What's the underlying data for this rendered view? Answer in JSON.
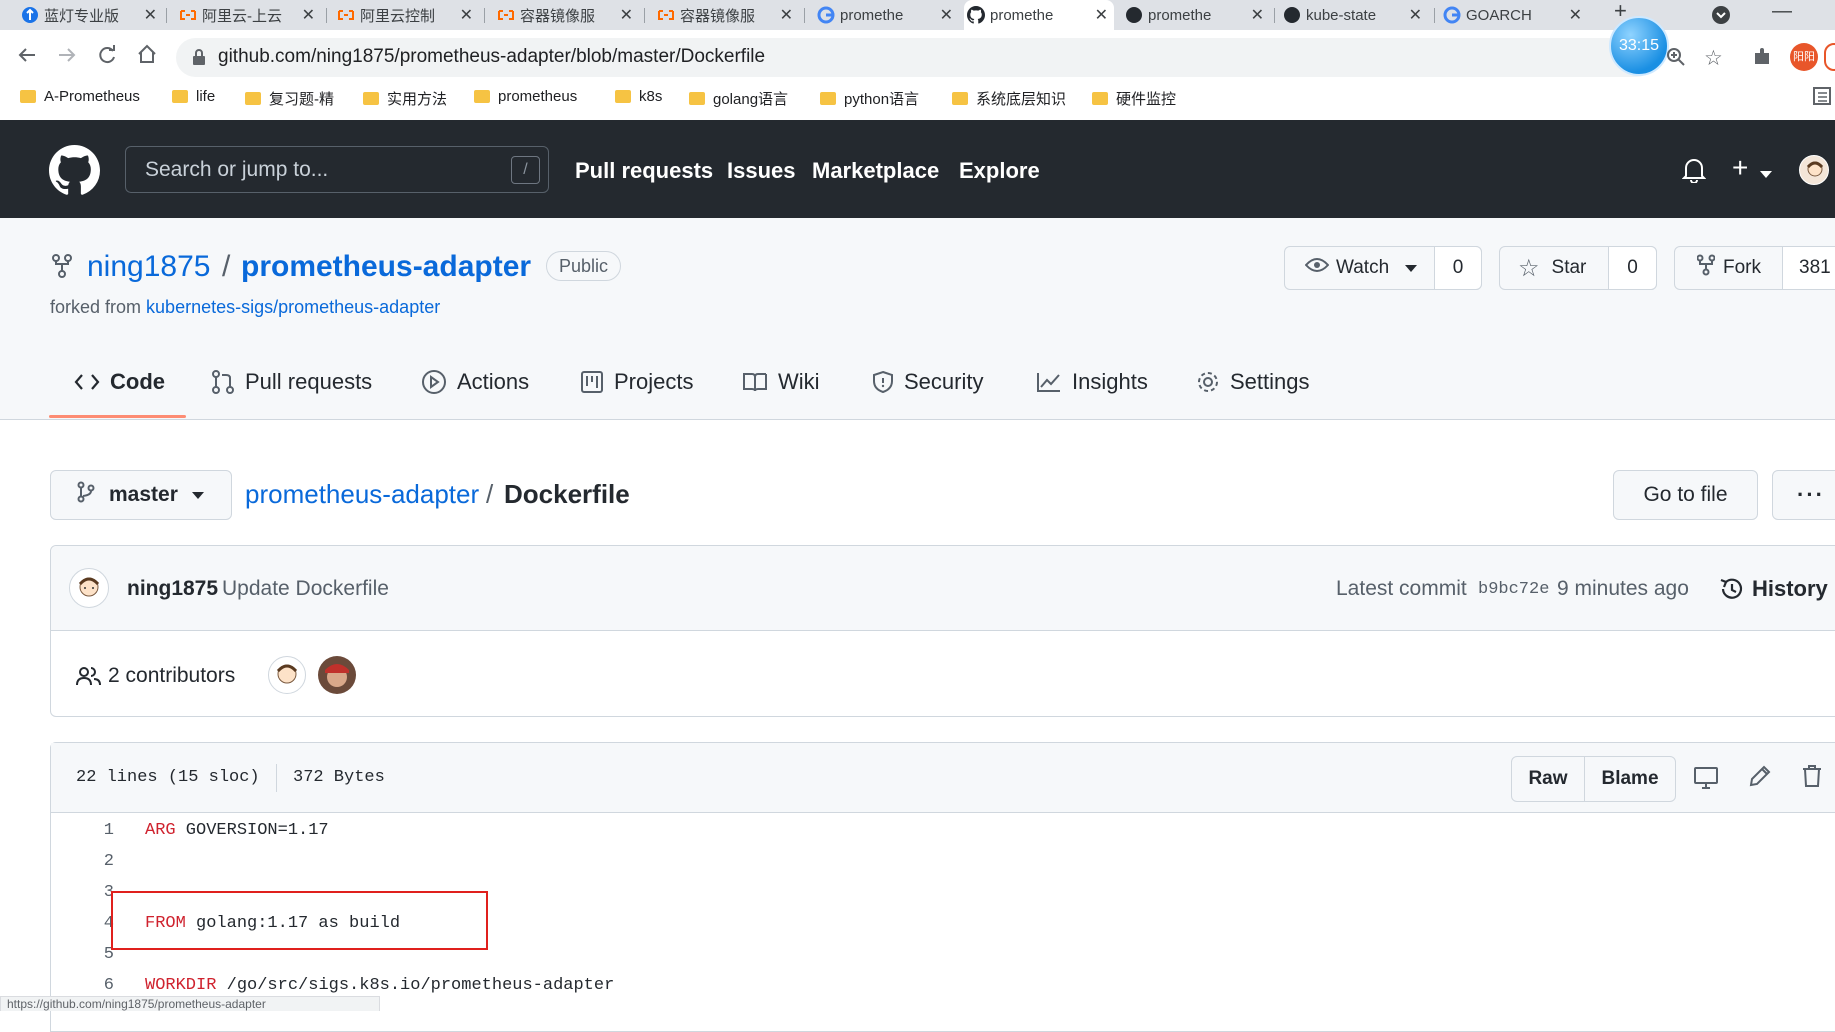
{
  "browser": {
    "tabs": [
      {
        "title": "蓝灯专业版",
        "icon": "lantern-icon"
      },
      {
        "title": "阿里云-上云",
        "icon": "aliyun-icon"
      },
      {
        "title": "阿里云控制",
        "icon": "aliyun-icon"
      },
      {
        "title": "容器镜像服",
        "icon": "aliyun-icon"
      },
      {
        "title": "容器镜像服",
        "icon": "aliyun-icon"
      },
      {
        "title": "promethe",
        "icon": "google-icon"
      },
      {
        "title": "promethe",
        "icon": "github-icon"
      },
      {
        "title": "promethe",
        "icon": "github-icon"
      },
      {
        "title": "kube-state",
        "icon": "github-icon"
      },
      {
        "title": "GOARCH",
        "icon": "google-icon"
      }
    ],
    "url": "github.com/ning1875/prometheus-adapter/blob/master/Dockerfile",
    "timer": "33:15",
    "profile_label": "阳阳",
    "bookmarks": [
      "A-Prometheus",
      "life",
      "复习题-精",
      "实用方法",
      "prometheus",
      "k8s",
      "golang语言",
      "python语言",
      "系统底层知识",
      "硬件监控"
    ],
    "status_url": "https://github.com/ning1875/prometheus-adapter"
  },
  "github": {
    "search_placeholder": "Search or jump to...",
    "search_shortcut": "/",
    "nav": [
      "Pull requests",
      "Issues",
      "Marketplace",
      "Explore"
    ]
  },
  "repo": {
    "owner": "ning1875",
    "separator": "/",
    "name": "prometheus-adapter",
    "visibility": "Public",
    "forked_from_label": "forked from",
    "forked_from": "kubernetes-sigs/prometheus-adapter",
    "watch_label": "Watch",
    "watch_count": "0",
    "star_label": "Star",
    "star_count": "0",
    "fork_label": "Fork",
    "fork_count": "381",
    "tabs": [
      {
        "label": "Code",
        "icon": "code-icon",
        "active": true
      },
      {
        "label": "Pull requests",
        "icon": "pull-request-icon"
      },
      {
        "label": "Actions",
        "icon": "play-icon"
      },
      {
        "label": "Projects",
        "icon": "project-icon"
      },
      {
        "label": "Wiki",
        "icon": "book-icon"
      },
      {
        "label": "Security",
        "icon": "shield-icon"
      },
      {
        "label": "Insights",
        "icon": "graph-icon"
      },
      {
        "label": "Settings",
        "icon": "gear-icon"
      }
    ]
  },
  "file": {
    "branch": "master",
    "repo_link": "prometheus-adapter",
    "separator": "/",
    "filename": "Dockerfile",
    "go_to_file": "Go to file",
    "commit_author": "ning1875",
    "commit_message": "Update Dockerfile",
    "latest_commit_label": "Latest commit",
    "commit_sha": "b9bc72e",
    "commit_time": "9 minutes ago",
    "history_label": "History",
    "contributors": "2 contributors",
    "stats_lines": "22 lines (15 sloc)",
    "stats_size": "372 Bytes",
    "raw_label": "Raw",
    "blame_label": "Blame",
    "code_lines": [
      {
        "num": "1",
        "keyword": "ARG",
        "rest": " GOVERSION=1.17"
      },
      {
        "num": "2",
        "keyword": "",
        "rest": ""
      },
      {
        "num": "3",
        "keyword": "",
        "rest": ""
      },
      {
        "num": "4",
        "keyword": "FROM",
        "rest": " golang:1.17 as build"
      },
      {
        "num": "5",
        "keyword": "",
        "rest": ""
      },
      {
        "num": "6",
        "keyword": "WORKDIR",
        "rest": " /go/src/sigs.k8s.io/prometheus-adapter"
      }
    ]
  },
  "colors": {
    "github_header": "#24292f",
    "link": "#0969da",
    "keyword": "#cf222e",
    "highlight_box": "#e0201d",
    "tab_underline": "#fd8c73"
  }
}
